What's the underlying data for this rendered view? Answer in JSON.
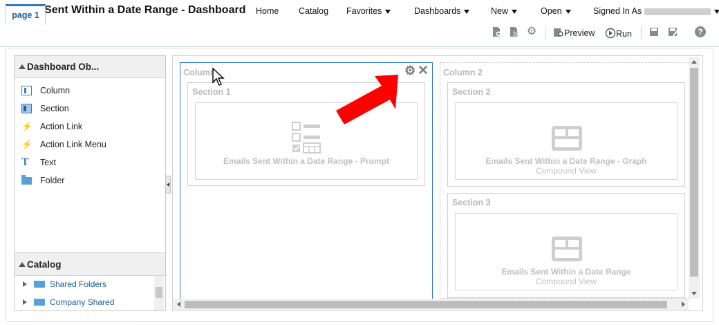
{
  "app": {
    "title": "Emails Sent Within a Date Range - Dashboard"
  },
  "nav": {
    "home": "Home",
    "catalog": "Catalog",
    "favorites": "Favorites",
    "dashboards": "Dashboards",
    "new": "New",
    "open": "Open",
    "signed_in": "Signed In As"
  },
  "tabs": [
    {
      "label": "page 1"
    }
  ],
  "toolbar": {
    "preview_label": "Preview",
    "run_label": "Run"
  },
  "objects_panel": {
    "title": "Dashboard Ob...",
    "items": [
      {
        "label": "Column",
        "icon": "column-icon"
      },
      {
        "label": "Section",
        "icon": "section-icon"
      },
      {
        "label": "Action Link",
        "icon": "action-link-icon"
      },
      {
        "label": "Action Link Menu",
        "icon": "action-link-menu-icon"
      },
      {
        "label": "Text",
        "icon": "text-icon"
      },
      {
        "label": "Folder",
        "icon": "folder-icon"
      }
    ]
  },
  "catalog_panel": {
    "title": "Catalog",
    "items": [
      {
        "label": "Shared Folders"
      },
      {
        "label": "Company Shared"
      }
    ]
  },
  "layout": {
    "column1": {
      "title": "Column",
      "section1": {
        "title": "Section 1",
        "view_title": "Emails Sent Within a Date Range - Prompt"
      }
    },
    "column2": {
      "title": "Column 2",
      "section2": {
        "title": "Section 2",
        "view_title": "Emails Sent Within a Date Range - Graph",
        "view_sub": "Compound View"
      },
      "section3": {
        "title": "Section 3",
        "view_title": "Emails Sent Within a Date Range",
        "view_sub": "Compound View"
      }
    }
  },
  "colors": {
    "accent": "#2f7ac2",
    "link": "#1c5d99",
    "arrow": "#ff0000"
  }
}
